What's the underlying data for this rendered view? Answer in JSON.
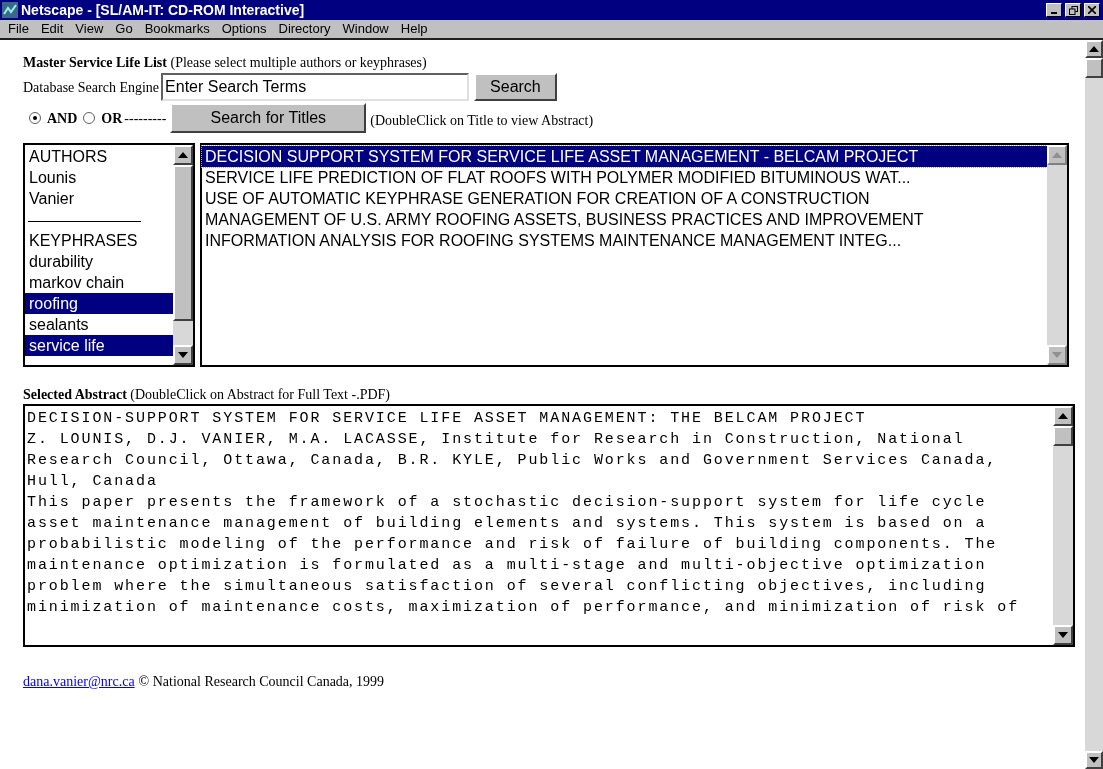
{
  "window": {
    "title": "Netscape - [SL/AM-IT: CD-ROM Interactive]"
  },
  "menu": [
    "File",
    "Edit",
    "View",
    "Go",
    "Bookmarks",
    "Options",
    "Directory",
    "Window",
    "Help"
  ],
  "heading": {
    "title": "Master Service Life List",
    "note": "(Please select multiple authors or keyphrases)"
  },
  "search": {
    "label": "Database Search Engine",
    "value": "Enter Search Terms",
    "button": "Search"
  },
  "mode": [
    {
      "label": "AND",
      "selected": true
    },
    {
      "label": "OR",
      "selected": false
    }
  ],
  "mode_dashes": "---------",
  "titles_button": "Search for Titles",
  "titles_hint": "(DoubleClick on Title to view Abstract)",
  "filter_list": [
    {
      "kind": "option",
      "text": "AUTHORS",
      "selected": false
    },
    {
      "kind": "option",
      "text": "Lounis",
      "selected": false
    },
    {
      "kind": "option",
      "text": "Vanier",
      "selected": false
    },
    {
      "kind": "separator",
      "text": "————————",
      "selected": false
    },
    {
      "kind": "option",
      "text": "KEYPHRASES",
      "selected": false
    },
    {
      "kind": "option",
      "text": "durability",
      "selected": false
    },
    {
      "kind": "option",
      "text": "markov chain",
      "selected": false
    },
    {
      "kind": "option",
      "text": "roofing",
      "selected": true
    },
    {
      "kind": "option",
      "text": "sealants",
      "selected": false
    },
    {
      "kind": "option",
      "text": "service life",
      "selected": true
    }
  ],
  "titles": [
    {
      "text": "DECISION SUPPORT SYSTEM FOR SERVICE LIFE ASSET MANAGEMENT - BELCAM PROJECT",
      "selected": true
    },
    {
      "text": "SERVICE LIFE PREDICTION OF FLAT ROOFS WITH POLYMER MODIFIED BITUMINOUS WAT...",
      "selected": false
    },
    {
      "text": "USE OF AUTOMATIC KEYPHRASE GENERATION FOR CREATION OF A CONSTRUCTION",
      "selected": false
    },
    {
      "text": "MANAGEMENT OF U.S. ARMY ROOFING ASSETS, BUSINESS PRACTICES AND IMPROVEMENT",
      "selected": false
    },
    {
      "text": "INFORMATION ANALYSIS FOR ROOFING SYSTEMS MAINTENANCE MANAGEMENT INTEG...",
      "selected": false
    }
  ],
  "abstract": {
    "title": "Selected Abstract",
    "note": "(DoubleClick on Abstract for Full Text -.PDF)",
    "lines": [
      "DECISION-SUPPORT SYSTEM FOR SERVICE LIFE ASSET MANAGEMENT: THE BELCAM PROJECT",
      "Z. LOUNIS, D.J. VANIER, M.A. LACASSE, Institute for Research in Construction, National",
      "Research Council, Ottawa, Canada, B.R. KYLE, Public Works and Government Services Canada,",
      "Hull, Canada",
      "This paper presents the framework of a stochastic decision-support system for life cycle",
      "asset maintenance management of building elements and systems. This system is based on a",
      "probabilistic modeling of the performance and risk of failure of building components. The",
      "maintenance optimization is formulated as a multi-stage and multi-objective optimization",
      "problem where the simultaneous satisfaction of several conflicting objectives, including",
      "minimization of maintenance costs, maximization of performance, and minimization of risk of"
    ]
  },
  "footer": {
    "link": "dana.vanier@nrc.ca",
    "text": "© National Research Council Canada, 1999"
  }
}
